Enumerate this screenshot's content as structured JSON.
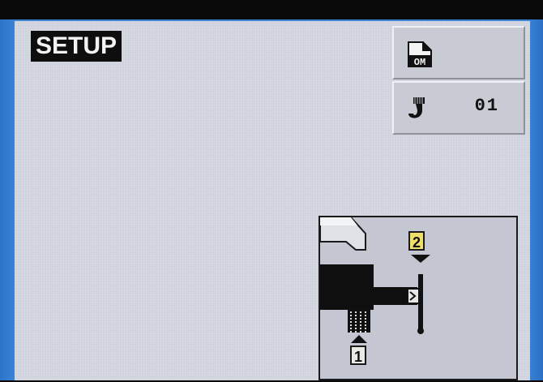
{
  "screen": {
    "title": "SETUP"
  },
  "side_buttons": {
    "program": {
      "icon": "document-om-icon",
      "label": "OM"
    },
    "tool": {
      "icon": "hook-tool-icon",
      "value": "01"
    }
  },
  "diagram": {
    "label_1": "1",
    "label_2": "2",
    "label_2_color": "#f0e06a"
  }
}
